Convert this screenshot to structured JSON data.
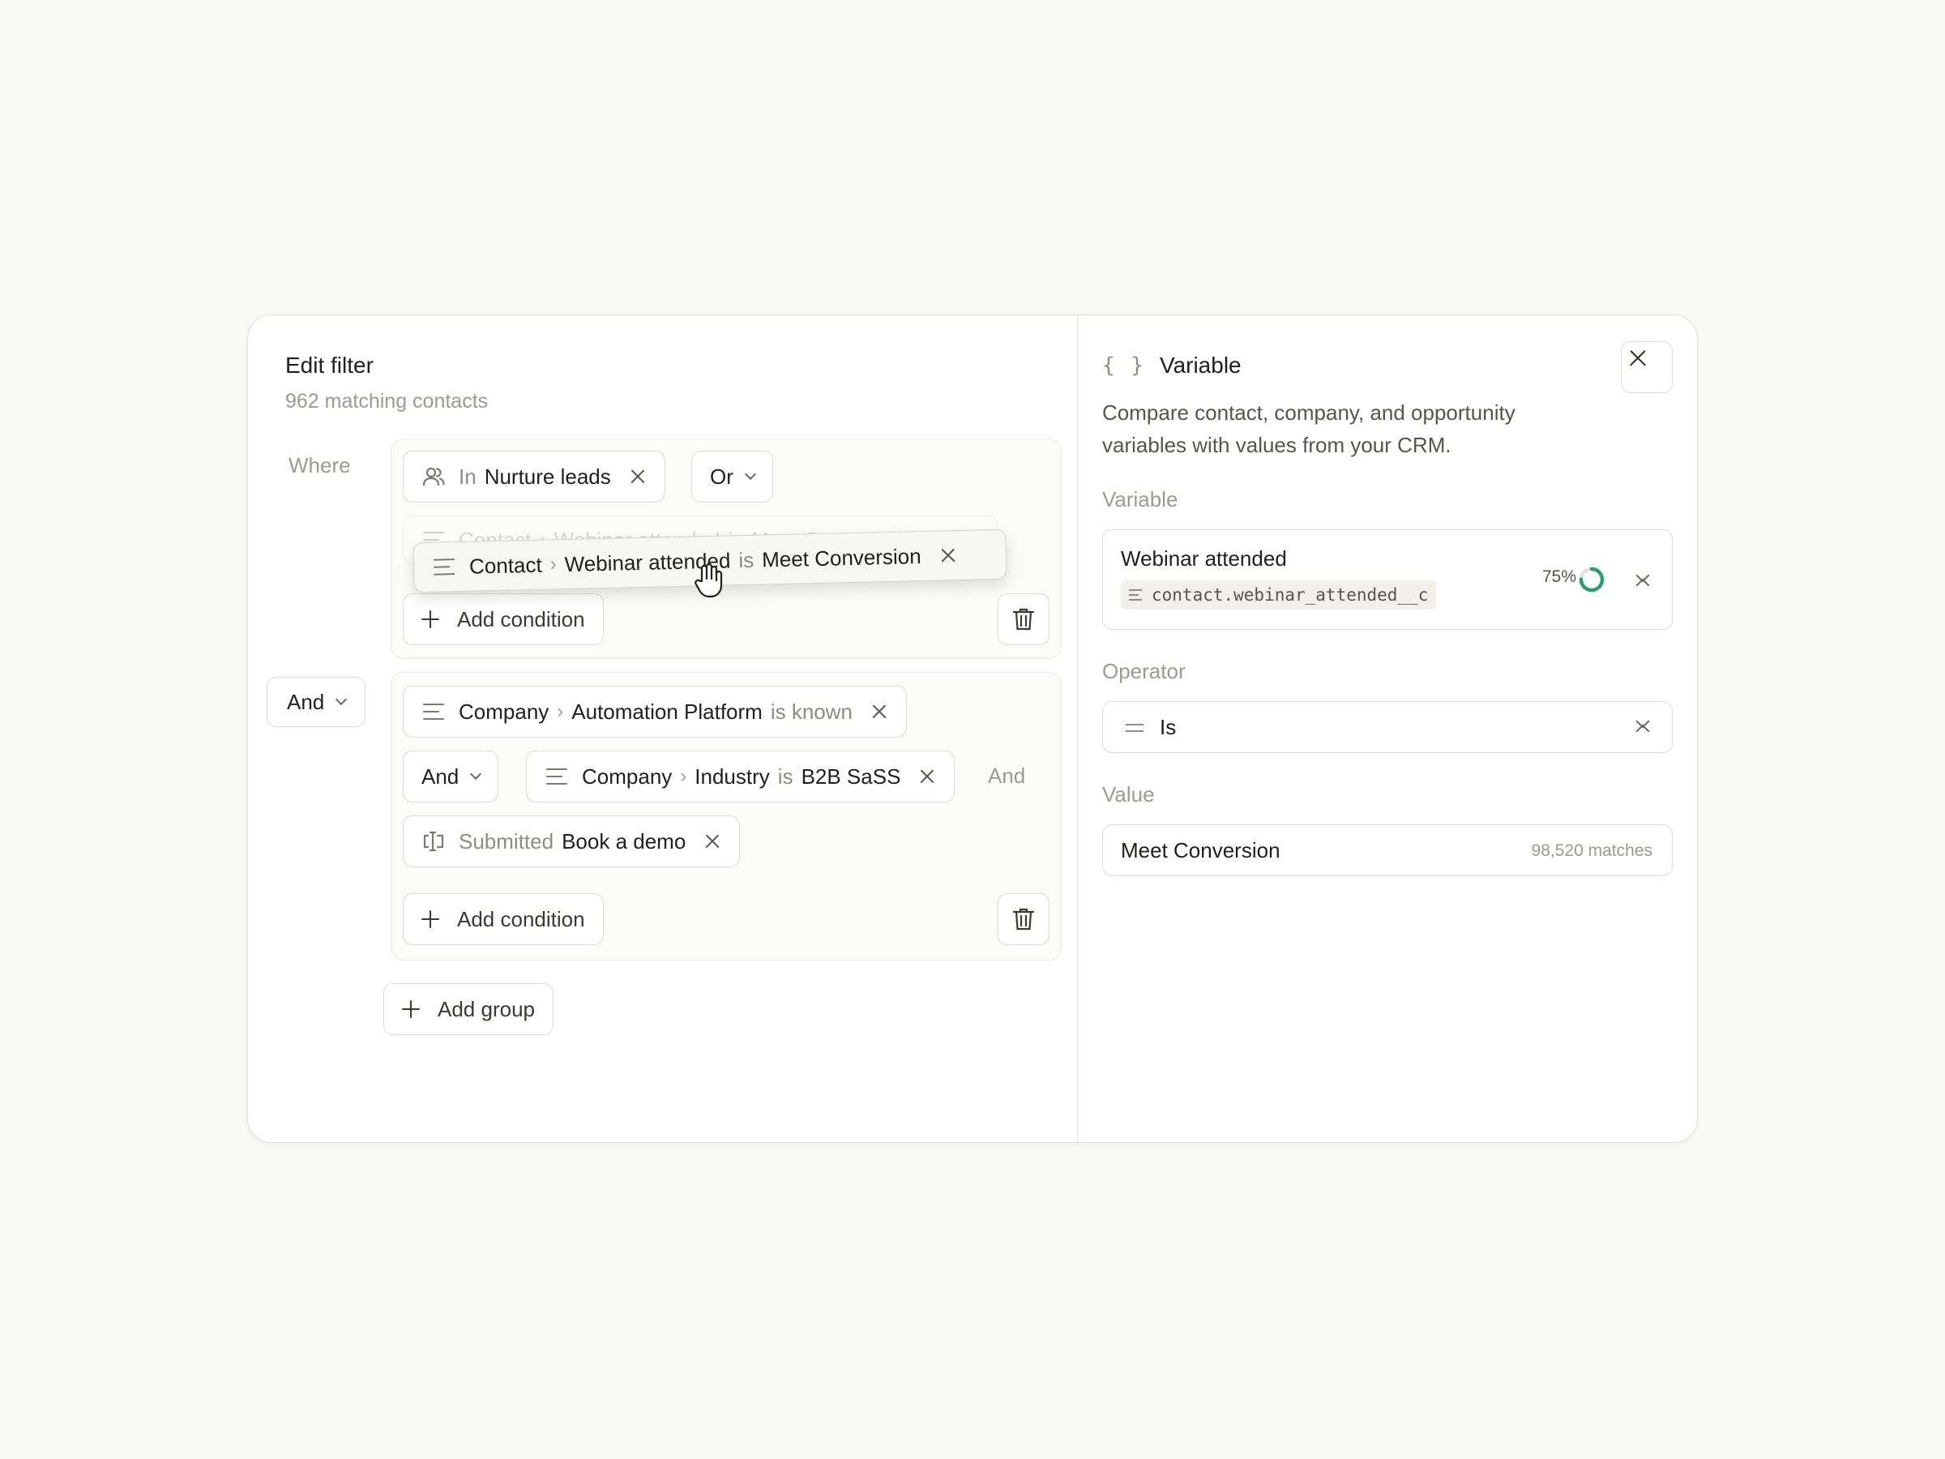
{
  "filter": {
    "title": "Edit filter",
    "subtitle": "962 matching contacts",
    "where_label": "Where",
    "group1": {
      "segment_chip": {
        "prefix": "In",
        "value": "Nurture leads"
      },
      "or_select": "Or",
      "ghost_chip": {
        "object": "Contact",
        "field": "Webinar attended",
        "op": "is",
        "value": "Meet Conversion"
      },
      "dragging_chip": {
        "object": "Contact",
        "field": "Webinar attended",
        "op": "is",
        "value": "Meet Conversion"
      },
      "add_condition": "Add condition"
    },
    "group_join": "And",
    "group2": {
      "chip1": {
        "object": "Company",
        "field": "Automation Platform",
        "op": "is known"
      },
      "and_select": "And",
      "chip2": {
        "object": "Company",
        "field": "Industry",
        "op": "is",
        "value": "B2B SaSS"
      },
      "trailing_and": "And",
      "chip3": {
        "prefix": "Submitted",
        "value": "Book a demo"
      },
      "add_condition": "Add condition"
    },
    "add_group": "Add group"
  },
  "variable_panel": {
    "braces": "{ }",
    "title": "Variable",
    "description": "Compare contact, company, and opportunity variables with values from your CRM.",
    "variable_label": "Variable",
    "variable_name": "Webinar attended",
    "variable_key": "contact.webinar_attended__c",
    "fill_rate": "75%",
    "fill_fraction": 0.75,
    "operator_label": "Operator",
    "operator_value": "Is",
    "value_label": "Value",
    "value_value": "Meet Conversion",
    "value_matches": "98,520 matches"
  },
  "colors": {
    "accent_green": "#2e9e6f",
    "border": "#dddcd7",
    "muted_text": "#9b9a95"
  },
  "icons": [
    "users-icon",
    "lines-icon",
    "chevron-down-icon",
    "close-icon",
    "plus-icon",
    "trash-icon",
    "form-icon",
    "braces-icon",
    "expand-icon",
    "equals-icon",
    "progress-ring-icon",
    "hand-cursor-icon"
  ]
}
